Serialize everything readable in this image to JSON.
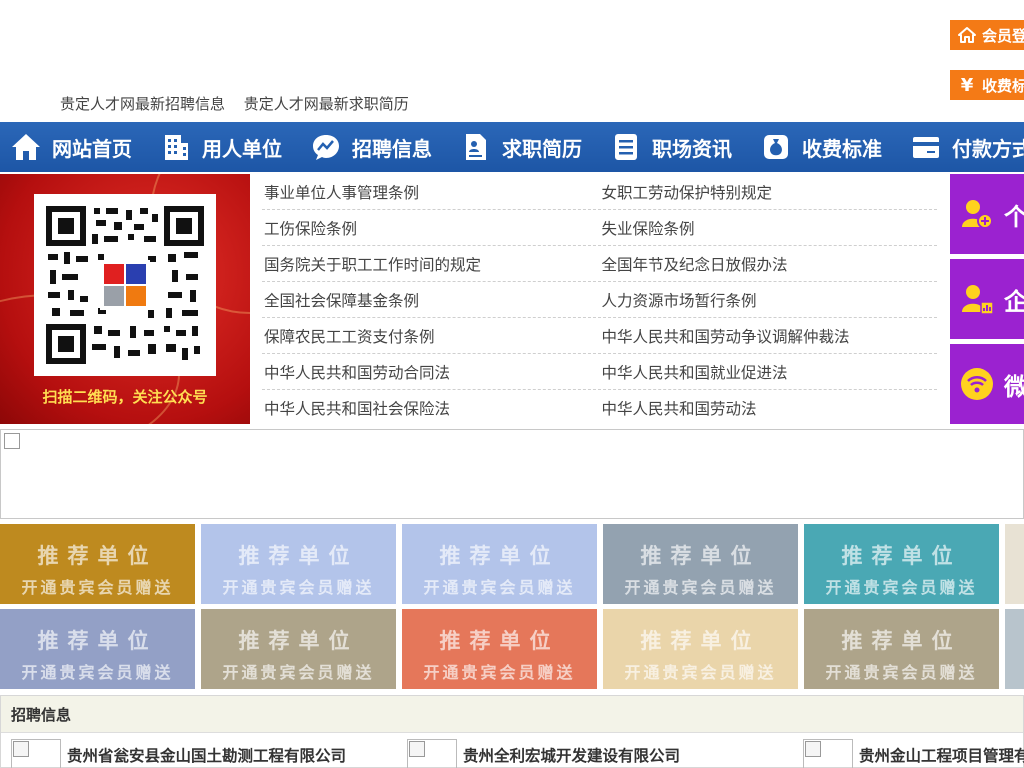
{
  "header": {
    "links": [
      "贵定人才网最新招聘信息",
      "贵定人才网最新求职简历"
    ],
    "login_label": "会员登",
    "fee_label": "收费标",
    "fee_icon": "yen-icon"
  },
  "nav": [
    {
      "label": "网站首页",
      "icon": "home-icon"
    },
    {
      "label": "用人单位",
      "icon": "building-icon"
    },
    {
      "label": "招聘信息",
      "icon": "chart-bubble-icon"
    },
    {
      "label": "求职简历",
      "icon": "resume-icon"
    },
    {
      "label": "职场资讯",
      "icon": "news-icon"
    },
    {
      "label": "收费标准",
      "icon": "money-bag-icon"
    },
    {
      "label": "付款方式",
      "icon": "card-icon"
    }
  ],
  "qr": {
    "caption": "扫描二维码，关注公众号"
  },
  "links": [
    [
      "事业单位人事管理条例",
      "女职工劳动保护特别规定"
    ],
    [
      "工伤保险条例",
      "失业保险条例"
    ],
    [
      "国务院关于职工工作时间的规定",
      "全国年节及纪念日放假办法"
    ],
    [
      "全国社会保障基金条例",
      "人力资源市场暂行条例"
    ],
    [
      "保障农民工工资支付条例",
      "中华人民共和国劳动争议调解仲裁法"
    ],
    [
      "中华人民共和国劳动合同法",
      "中华人民共和国就业促进法"
    ],
    [
      "中华人民共和国社会保险法",
      "中华人民共和国劳动法"
    ]
  ],
  "side_tiles": [
    "个",
    "企",
    "微"
  ],
  "recommend": {
    "line1": "推荐单位",
    "line2": "开通贵宾会员赠送",
    "colors": [
      "#be8a1f",
      "#b3c4ea",
      "#b3c4ea",
      "#93a2b0",
      "#4aa8b4",
      "#e8e2d4",
      "#93a0c6",
      "#aea48a",
      "#e5775a",
      "#ead5aa",
      "#aea48a",
      "#b8c4cc"
    ]
  },
  "jobs": {
    "title": "招聘信息",
    "items": [
      "贵州省瓮安县金山国土勘测工程有限公司",
      "贵州全利宏城开发建设有限公司",
      "贵州金山工程项目管理有"
    ]
  }
}
